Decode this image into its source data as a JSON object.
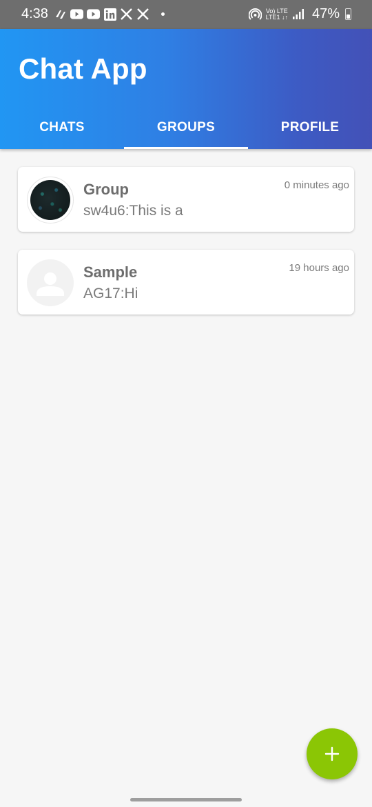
{
  "status_bar": {
    "time": "4:38",
    "network_top": "Vo) LTE",
    "network_bottom": "LTE1 ↓↑",
    "battery_percent": "47%",
    "battery_level": 0.47,
    "notification_icons": [
      "pinwheel-icon",
      "youtube-icon",
      "youtube-icon",
      "linkedin-icon",
      "x-icon",
      "x-icon"
    ]
  },
  "app": {
    "title": "Chat App",
    "header_gradient": [
      "#2196f3",
      "#4351b7"
    ],
    "accent_color": "#8bc605"
  },
  "tabs": [
    {
      "label": "CHATS",
      "active": false
    },
    {
      "label": "GROUPS",
      "active": true
    },
    {
      "label": "PROFILE",
      "active": false
    }
  ],
  "groups": [
    {
      "name": "Group",
      "last_message": "sw4u6:This is a",
      "time": "0 minutes ago",
      "avatar": "group-photo"
    },
    {
      "name": "Sample",
      "last_message": "AG17:Hi",
      "time": "19 hours ago",
      "avatar": "default-person"
    }
  ],
  "fab": {
    "icon": "plus-icon"
  }
}
